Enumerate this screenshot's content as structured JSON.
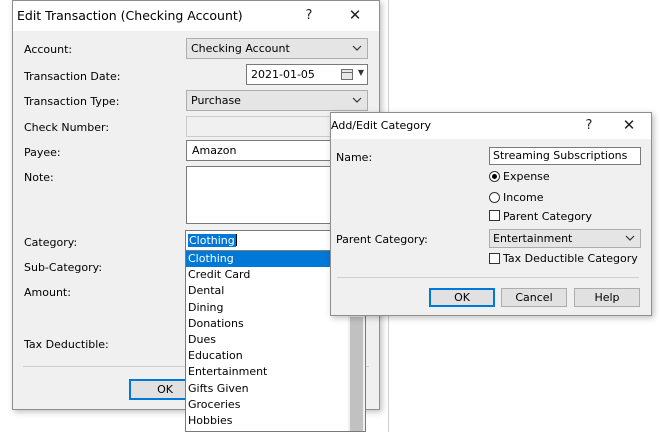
{
  "main_dialog": {
    "title": "Edit Transaction (Checking Account)",
    "help_glyph": "?",
    "close_glyph": "✕",
    "labels": {
      "account": "Account:",
      "transaction_date": "Transaction Date:",
      "transaction_type": "Transaction Type:",
      "check_number": "Check Number:",
      "payee": "Payee:",
      "note": "Note:",
      "category": "Category:",
      "sub_category": "Sub-Category:",
      "amount": "Amount:",
      "tax_deductible": "Tax Deductible:"
    },
    "account_value": "Checking Account",
    "transaction_date_value": "2021-01-05",
    "transaction_type_value": "Purchase",
    "check_number_value": "",
    "payee_value": "Amazon",
    "note_value": "",
    "category_value": "Clothing",
    "ok_label": "OK",
    "icons": {
      "account_dropdown": "chevron-down-icon",
      "date_picker": "calendar-icon",
      "type_dropdown": "chevron-down-icon"
    }
  },
  "category_dropdown": {
    "items": [
      {
        "label": "Clothing",
        "selected": true
      },
      {
        "label": "Credit Card"
      },
      {
        "label": "Dental"
      },
      {
        "label": "Dining"
      },
      {
        "label": "Donations"
      },
      {
        "label": "Dues"
      },
      {
        "label": "Education"
      },
      {
        "label": "Entertainment"
      },
      {
        "label": "Gifts Given"
      },
      {
        "label": "Groceries"
      },
      {
        "label": "Hobbies"
      }
    ]
  },
  "category_dialog": {
    "title": "Add/Edit Category",
    "help_glyph": "?",
    "close_glyph": "✕",
    "name_label": "Name:",
    "name_value": "Streaming Subscriptions",
    "expense_label": "Expense",
    "expense_selected": true,
    "income_label": "Income",
    "parent_category_checkbox_label": "Parent Category",
    "parent_category_label": "Parent Category:",
    "parent_category_value": "Entertainment",
    "tax_deductible_label": "Tax Deductible Category",
    "ok_label": "OK",
    "cancel_label": "Cancel",
    "help_label": "Help"
  },
  "colors": {
    "selection": "#0078d7",
    "dialog_bg": "#f0f0f0"
  }
}
